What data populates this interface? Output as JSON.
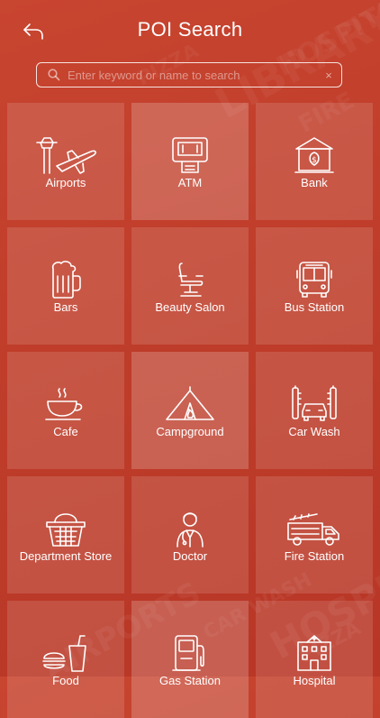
{
  "header": {
    "title": "POI Search"
  },
  "search": {
    "placeholder": "Enter keyword or name to search",
    "clear": "×"
  },
  "background_words": [
    "LIBRARY",
    "HOSPITAL",
    "PIZZA",
    "FIRE",
    "AIRPORTS",
    "CAR WASH",
    "HOSPITAL",
    "PIZZA"
  ],
  "categories": [
    {
      "label": "Airports",
      "icon": "airport-icon"
    },
    {
      "label": "ATM",
      "icon": "atm-icon"
    },
    {
      "label": "Bank",
      "icon": "bank-icon"
    },
    {
      "label": "Bars",
      "icon": "beer-mug-icon"
    },
    {
      "label": "Beauty Salon",
      "icon": "salon-chair-icon"
    },
    {
      "label": "Bus Station",
      "icon": "bus-icon"
    },
    {
      "label": "Cafe",
      "icon": "coffee-cup-icon"
    },
    {
      "label": "Campground",
      "icon": "tent-icon"
    },
    {
      "label": "Car Wash",
      "icon": "car-wash-icon"
    },
    {
      "label": "Department Store",
      "icon": "basket-icon"
    },
    {
      "label": "Doctor",
      "icon": "doctor-icon"
    },
    {
      "label": "Fire Station",
      "icon": "fire-truck-icon"
    },
    {
      "label": "Food",
      "icon": "food-icon"
    },
    {
      "label": "Gas Station",
      "icon": "gas-pump-icon"
    },
    {
      "label": "Hospital",
      "icon": "hospital-icon"
    }
  ],
  "colors": {
    "background": "#c0402b",
    "tile": "rgba(255,255,255,0.13)",
    "text": "#ffffff"
  }
}
